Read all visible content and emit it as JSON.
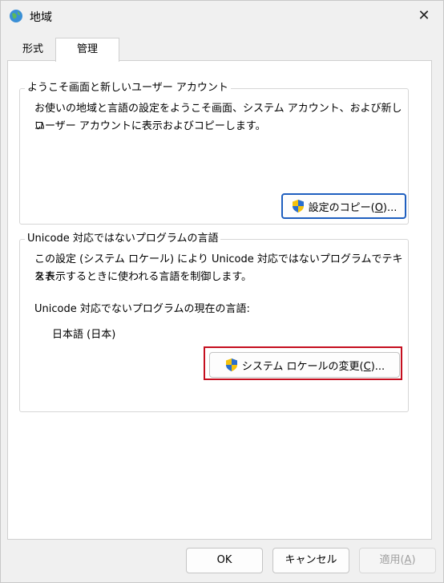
{
  "window": {
    "title": "地域",
    "close_icon": "close-icon",
    "app_icon": "globe-icon"
  },
  "tabs": [
    {
      "label": "形式",
      "selected": false
    },
    {
      "label": "管理",
      "selected": true
    }
  ],
  "welcome_group": {
    "legend": "ようこそ画面と新しいユーザー アカウント",
    "line1": "お使いの地域と言語の設定をようこそ画面、システム アカウント、および新しい",
    "line2": "ユーザー アカウントに表示およびコピーします。",
    "copy_button_prefix": "設定のコピー(",
    "copy_button_key": "O",
    "copy_button_suffix": ")..."
  },
  "unicode_group": {
    "legend": "Unicode 対応ではないプログラムの言語",
    "line1": "この設定 (システム ロケール) により Unicode 対応ではないプログラムでテキスト",
    "line2": "を表示するときに使われる言語を制御します。",
    "current_label": "Unicode 対応でないプログラムの現在の言語:",
    "current_value": "日本語 (日本)",
    "change_button_prefix": "システム ロケールの変更(",
    "change_button_key": "C",
    "change_button_suffix": ")..."
  },
  "footer": {
    "ok": "OK",
    "cancel": "キャンセル",
    "apply_prefix": "適用(",
    "apply_key": "A",
    "apply_suffix": ")"
  },
  "colors": {
    "highlight_border": "#c50f1f",
    "focus_border": "#1f5fbf"
  }
}
